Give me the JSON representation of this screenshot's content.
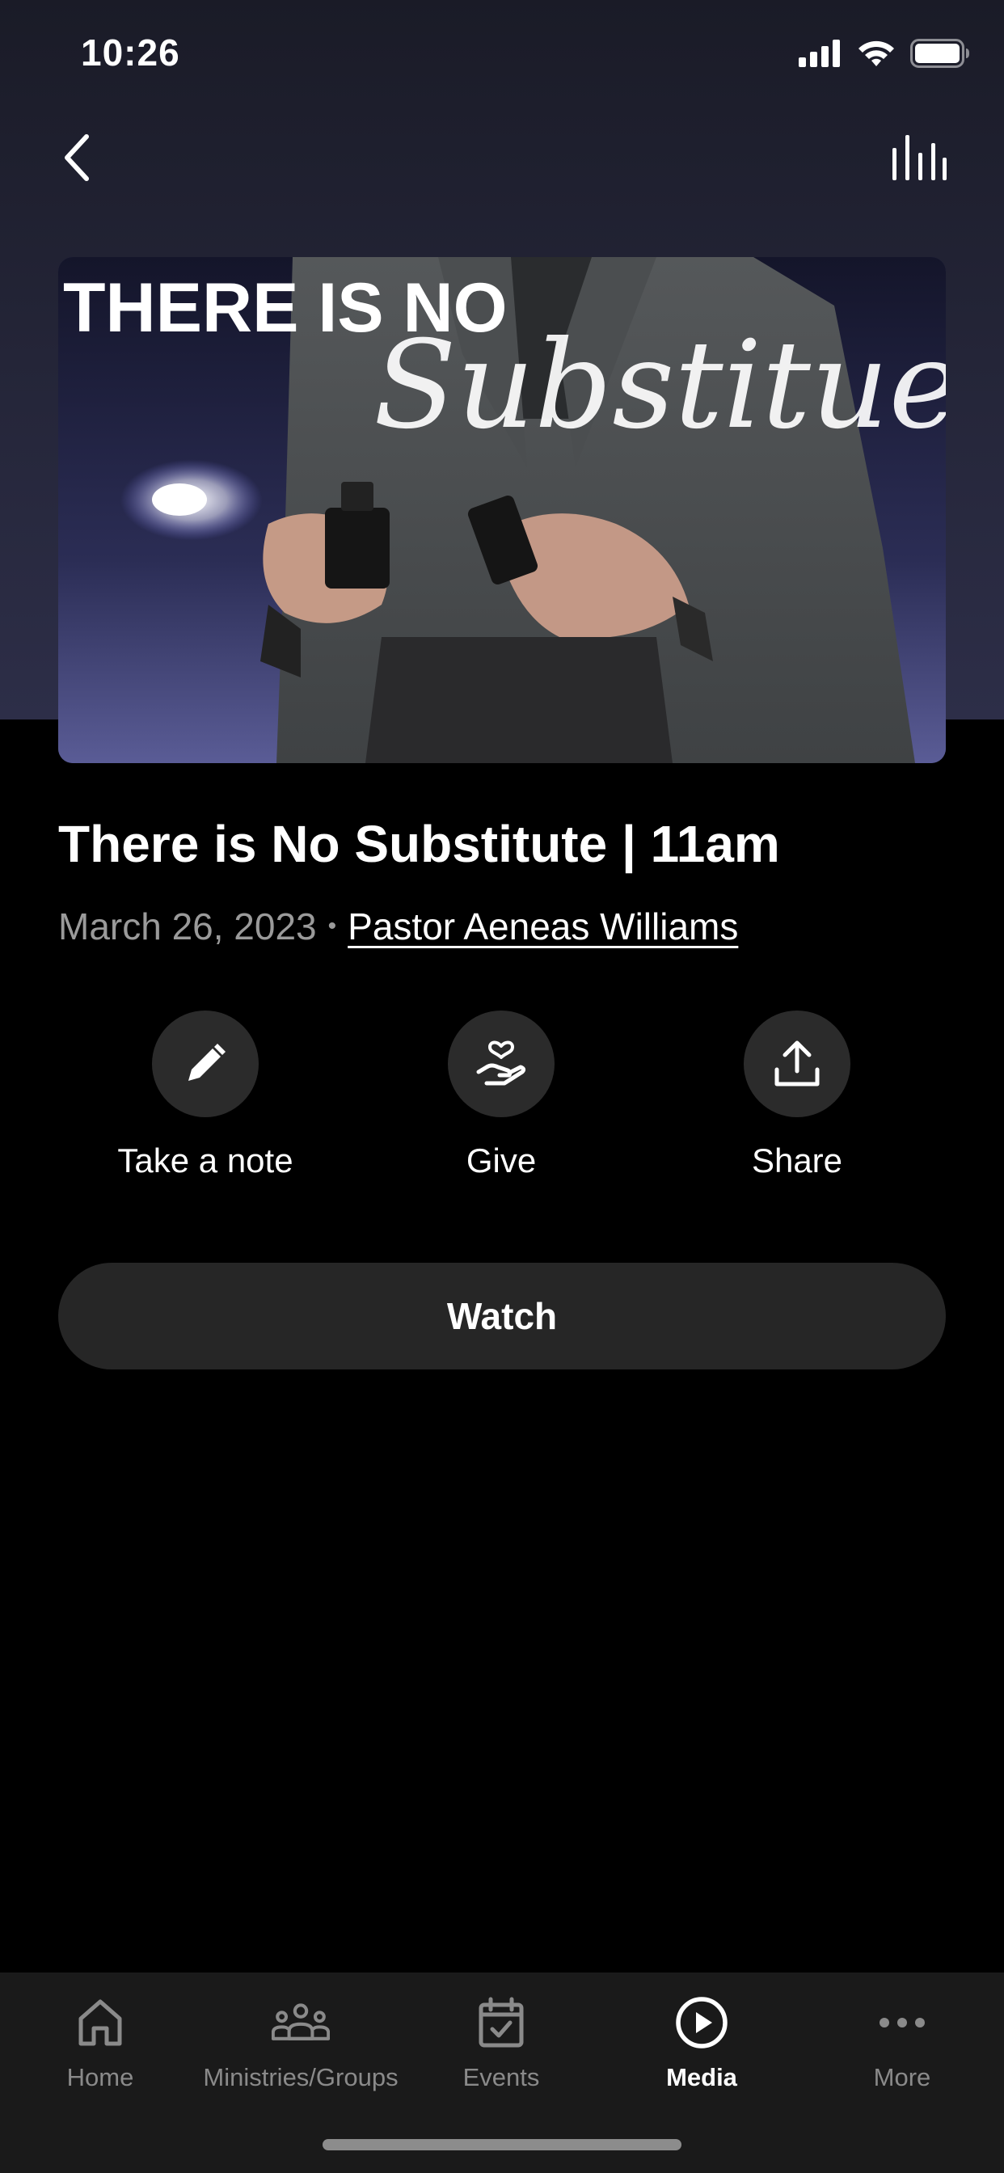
{
  "status_bar": {
    "time": "10:26"
  },
  "hero": {
    "line1": "THERE IS NO",
    "line2": "Substitue"
  },
  "sermon": {
    "title": "There is No Substitute | 11am",
    "date": "March 26, 2023",
    "separator": "•",
    "author": "Pastor Aeneas Williams"
  },
  "actions": [
    {
      "label": "Take a note",
      "icon": "pencil-icon"
    },
    {
      "label": "Give",
      "icon": "give-hand-heart-icon"
    },
    {
      "label": "Share",
      "icon": "share-upload-icon"
    }
  ],
  "watch": {
    "label": "Watch"
  },
  "tabs": [
    {
      "label": "Home",
      "icon": "home-icon",
      "active": false
    },
    {
      "label": "Ministries/Groups",
      "icon": "groups-icon",
      "active": false
    },
    {
      "label": "Events",
      "icon": "calendar-icon",
      "active": false
    },
    {
      "label": "Media",
      "icon": "play-circle-icon",
      "active": true
    },
    {
      "label": "More",
      "icon": "more-dots-icon",
      "active": false
    }
  ],
  "colors": {
    "background": "#000000",
    "header_gradient_top": "#1a1b27",
    "header_gradient_bottom": "#2d2e48",
    "action_circle": "#2b2b2b",
    "button": "#262626",
    "tab_bar": "#1a1a1a",
    "tab_inactive": "#8a8a8a",
    "tab_active": "#ffffff",
    "meta_text": "#9a9a9a"
  }
}
